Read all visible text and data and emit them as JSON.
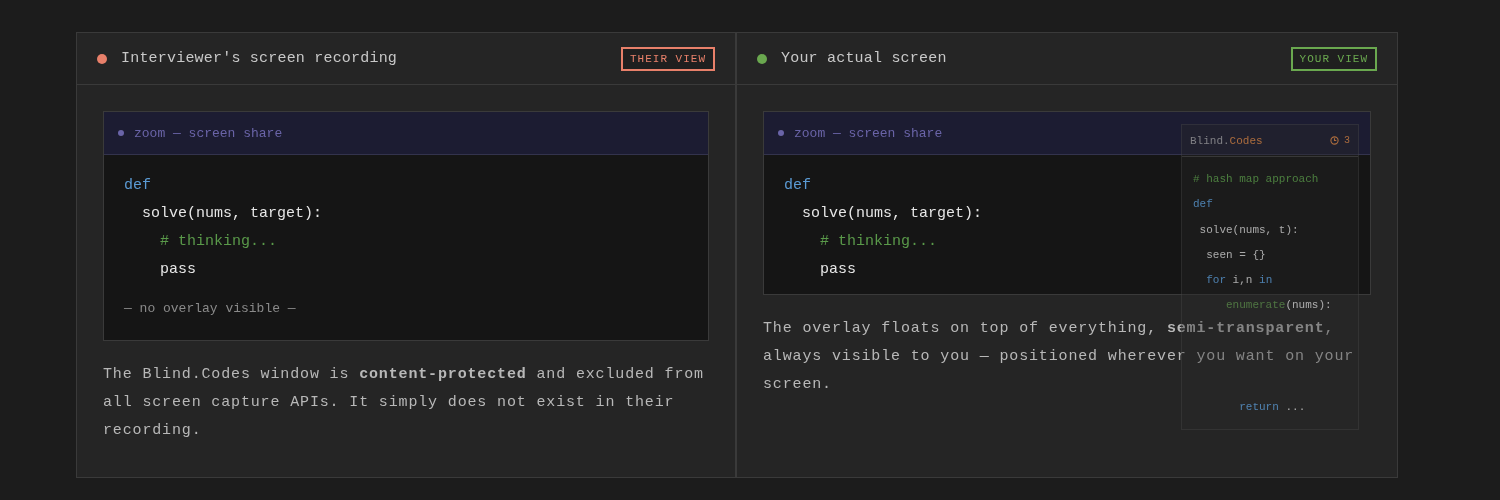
{
  "panels": [
    {
      "kind": "recording",
      "status_dot": {
        "color": "#e8806a"
      },
      "title": "Interviewer's screen recording",
      "badge": {
        "text": "THEIR VIEW",
        "color": "#e8806a"
      },
      "code_window": {
        "title": "zoom — screen share",
        "lines": [
          [
            {
              "text": "def",
              "kind": "keyword"
            }
          ],
          [
            {
              "text": "  solve(nums, target):",
              "kind": "plain"
            }
          ],
          [
            {
              "text": "    # thinking...",
              "kind": "comment"
            }
          ],
          [
            {
              "text": "    pass",
              "kind": "plain"
            }
          ]
        ],
        "footer": "— no overlay visible —"
      },
      "description": "The Blind.Codes window is **content-protected** and excluded from all screen capture APIs. It simply does not exist in their recording."
    },
    {
      "kind": "actual",
      "status_dot": {
        "color": "#6aa84f"
      },
      "title": "Your actual screen",
      "badge": {
        "text": "YOUR VIEW",
        "color": "#6aa84f"
      },
      "code_window": {
        "title": "zoom — screen share",
        "lines": [
          [
            {
              "text": "def",
              "kind": "keyword"
            }
          ],
          [
            {
              "text": "  solve(nums, target):",
              "kind": "plain"
            }
          ],
          [
            {
              "text": "    # thinking...",
              "kind": "comment"
            }
          ],
          [
            {
              "text": "    pass",
              "kind": "plain"
            }
          ]
        ]
      },
      "description": "The overlay floats on top of everything, **semi-transparent**, always visible to you — positioned wherever you want on your screen.",
      "overlay": {
        "title": [
          {
            "text": "Blind.",
            "kind": "plain"
          },
          {
            "text": "Codes",
            "kind": "accent"
          }
        ],
        "counter": "3",
        "lines": [
          [
            {
              "text": "# hash map approach",
              "kind": "comment"
            }
          ],
          [
            {
              "text": "def",
              "kind": "keyword"
            }
          ],
          [
            {
              "text": " solve(nums, t):",
              "kind": "plain"
            }
          ],
          [
            {
              "text": "  seen = {}",
              "kind": "plain"
            }
          ],
          [
            {
              "text": "  for",
              "kind": "keyword"
            },
            {
              "text": " i,n ",
              "kind": "plain"
            },
            {
              "text": "in",
              "kind": "keyword"
            }
          ],
          [
            {
              "text": "     enumerate",
              "kind": "fn"
            },
            {
              "text": "(nums):",
              "kind": "plain"
            }
          ],
          [
            {
              "text": "       return",
              "kind": "keyword"
            },
            {
              "text": " ...",
              "kind": "plain"
            }
          ]
        ]
      }
    }
  ]
}
